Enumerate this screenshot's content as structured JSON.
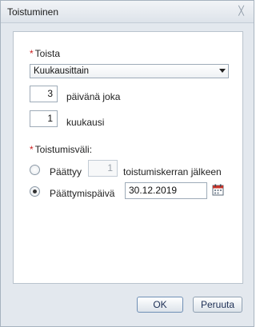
{
  "window": {
    "title": "Toistuminen",
    "close_icon": "close-icon"
  },
  "repeat": {
    "label": "Toista",
    "required_marker": "*",
    "select_value": "Kuukausittain"
  },
  "day": {
    "value": "3",
    "label": "päivänä joka"
  },
  "month": {
    "value": "1",
    "label": "kuukausi"
  },
  "interval": {
    "label": "Toistumisväli:",
    "required_marker": "*",
    "ends_after": {
      "label": "Päättyy",
      "value": "1",
      "suffix": "toistumiskerran jälkeen",
      "checked": false
    },
    "end_date": {
      "label": "Päättymispäivä",
      "value": "30.12.2019",
      "checked": true,
      "icon": "calendar-icon"
    }
  },
  "buttons": {
    "ok": "OK",
    "cancel": "Peruuta"
  }
}
